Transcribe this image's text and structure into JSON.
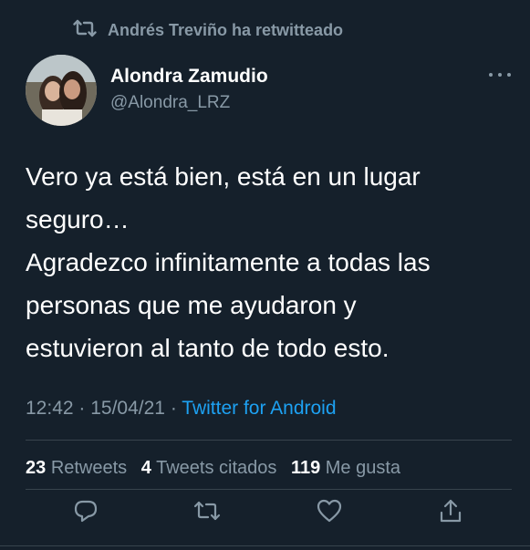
{
  "retweet_context": {
    "label": "Andrés Treviño ha retwitteado"
  },
  "author": {
    "name": "Alondra Zamudio",
    "handle": "@Alondra_LRZ"
  },
  "tweet": {
    "lines": [
      "Vero ya está bien, está en un lugar",
      "seguro…",
      "Agradezco infinitamente a todas las",
      "personas que me ayudaron y",
      "estuvieron al tanto de todo esto."
    ]
  },
  "meta": {
    "time": "12:42",
    "date": "15/04/21",
    "source": "Twitter for Android"
  },
  "stats": {
    "retweets_count": "23",
    "retweets_label": "Retweets",
    "quotes_count": "4",
    "quotes_label": "Tweets citados",
    "likes_count": "119",
    "likes_label": "Me gusta"
  },
  "icons": {
    "retweet_context": "retweet-icon",
    "more": "more-horizontal-icon",
    "reply": "reply-icon",
    "retweet": "retweet-icon",
    "like": "heart-icon",
    "share": "share-icon"
  },
  "colors": {
    "background": "#15202b",
    "text": "#ffffff",
    "muted": "#8899a6",
    "link": "#1da1f2",
    "divider": "#38444d"
  }
}
